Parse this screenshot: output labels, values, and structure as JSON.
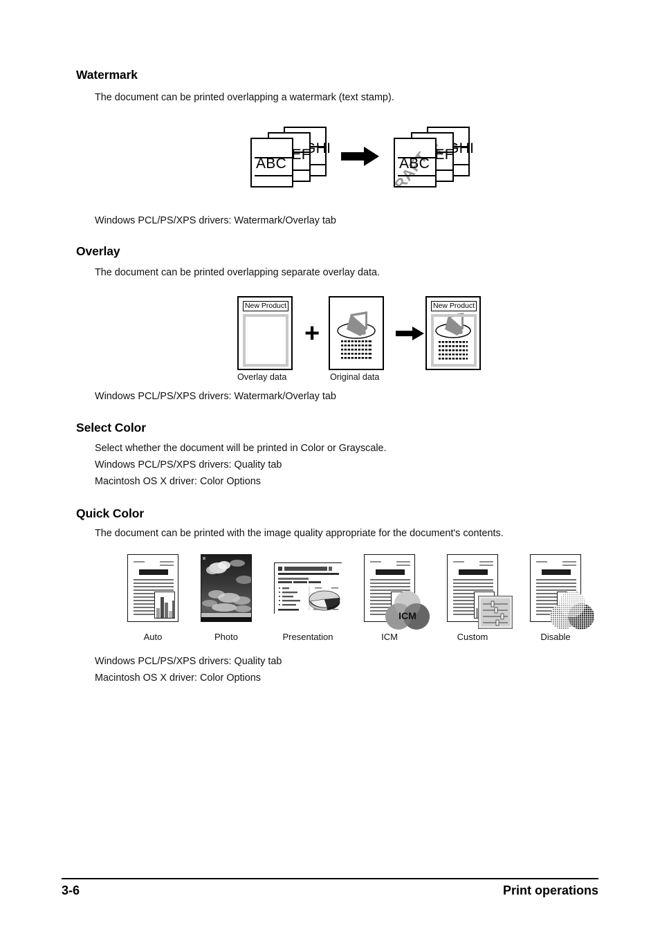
{
  "document": {
    "page_number": "3-6",
    "running_title": "Print operations"
  },
  "sections": [
    {
      "heading": "Watermark",
      "body": "The document can be printed overlapping a watermark (text stamp).",
      "driver_note_1": "Windows PCL/PS/XPS drivers: Watermark/Overlay tab",
      "figure": {
        "pages_before": [
          "ABC",
          "DEF",
          "GHI"
        ],
        "pages_after": [
          "ABC",
          "DEF",
          "GHI"
        ],
        "watermark_text": "DRAFT",
        "watermark_color": "#9a9a9a",
        "arrow": "right-arrow-icon"
      }
    },
    {
      "heading": "Overlay",
      "body": "The document can be printed overlapping separate overlay data.",
      "driver_note_1": "Windows PCL/PS/XPS drivers: Watermark/Overlay tab",
      "figure": {
        "overlay_label": "New Product",
        "caption_left": "Overlay data",
        "caption_middle": "Original data",
        "plus": "+",
        "arrow": "right-arrow-icon",
        "result_label": "New Product"
      }
    },
    {
      "heading": "Select Color",
      "body": "Select whether the document will be printed in Color or Grayscale.",
      "driver_note_1": "Windows PCL/PS/XPS drivers: Quality tab",
      "driver_note_2": "Macintosh OS X driver: Color Options"
    },
    {
      "heading": "Quick Color",
      "body": "The document can be printed with the image quality appropriate for the document's contents.",
      "driver_note_1": "Windows PCL/PS/XPS drivers: Quality tab",
      "driver_note_2": "Macintosh OS X driver: Color Options",
      "thumbnails": [
        {
          "label": "Auto",
          "kind": "text-and-bar-chart"
        },
        {
          "label": "Photo",
          "kind": "photograph-clouds"
        },
        {
          "label": "Presentation",
          "kind": "slide-with-pie-chart"
        },
        {
          "label": "ICM",
          "kind": "text-page-with-icm-circles",
          "badge": "ICM"
        },
        {
          "label": "Custom",
          "kind": "text-page-with-slider-panel"
        },
        {
          "label": "Disable",
          "kind": "text-page-with-halftone-circles"
        }
      ]
    }
  ]
}
